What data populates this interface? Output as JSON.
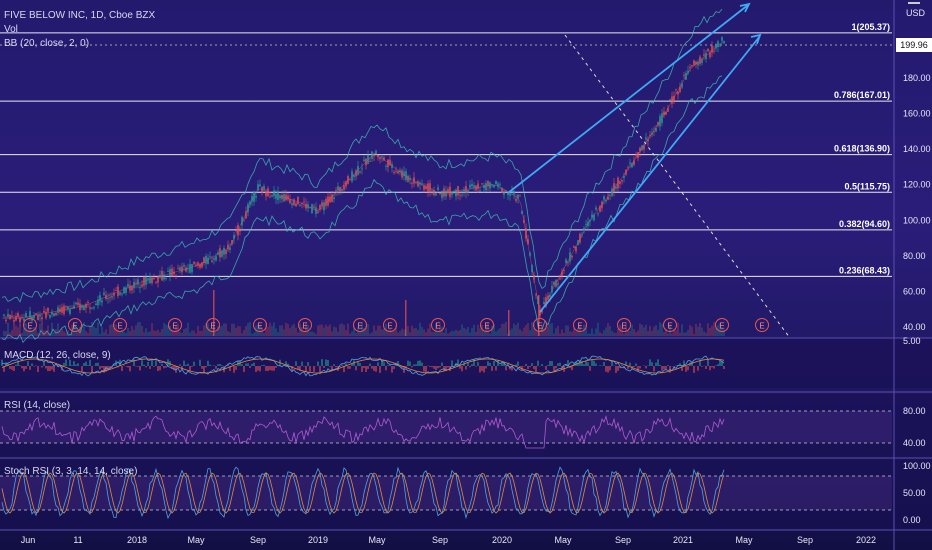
{
  "header": {
    "symbol_line": "FIVE BELOW INC, 1D, Cboe BZX",
    "vol_label": "Vol",
    "bb_label": "BB (20, close, 2, 0)"
  },
  "price_axis": {
    "currency": "USD",
    "ticks": [
      "180.00",
      "160.00",
      "140.00",
      "120.00",
      "100.00",
      "80.00",
      "60.00",
      "40.00"
    ],
    "last_price": "199.96"
  },
  "fib_levels": [
    {
      "label": "1(205.37)",
      "value": 205.37
    },
    {
      "label": "0.786(167.01)",
      "value": 167.01
    },
    {
      "label": "0.618(136.90)",
      "value": 136.9
    },
    {
      "label": "0.5(115.75)",
      "value": 115.75
    },
    {
      "label": "0.382(94.60)",
      "value": 94.6
    },
    {
      "label": "0.236(68.43)",
      "value": 68.43
    }
  ],
  "indicators": {
    "macd_label": "MACD (12, 26, close, 9)",
    "macd_tick": "5.00",
    "rsi_label": "RSI (14, close)",
    "rsi_ticks": [
      "80.00",
      "40.00"
    ],
    "stoch_label": "Stoch RSI (3, 3, 14, 14, close)",
    "stoch_ticks": [
      "100.00",
      "50.00",
      "0.00"
    ]
  },
  "time_axis": {
    "labels": [
      "Jun",
      "11",
      "2018",
      "May",
      "Sep",
      "2019",
      "May",
      "Sep",
      "2020",
      "May",
      "Sep",
      "2021",
      "May",
      "Sep",
      "2022"
    ]
  },
  "earnings_marker": "E",
  "colors": {
    "trendline": "#3fa9f5",
    "fib_line": "#ffffff",
    "bull": "#26a69a",
    "bear": "#ef5350",
    "rsi": "#b05bd0",
    "stoch_k": "#4fa3e0",
    "stoch_d": "#e08a3f"
  },
  "chart_data": {
    "type": "candlestick",
    "title": "FIVE BELOW INC, 1D, Cboe BZX",
    "y_ticks": [
      180,
      160,
      140,
      120,
      100,
      80,
      60,
      40
    ],
    "ylim": [
      35,
      215
    ],
    "x_labels": [
      "Jun",
      "11",
      "2018",
      "May",
      "Sep",
      "2019",
      "May",
      "Sep",
      "2020",
      "May",
      "Sep",
      "2021",
      "May",
      "Sep",
      "2022"
    ],
    "series": [
      {
        "x": [
          "Jun 2017",
          "Sep 2017",
          "Jan 2018",
          "May 2018",
          "Jul 2018",
          "Sep 2018",
          "Dec 2018",
          "Jan 2019",
          "Apr 2019",
          "Jul 2019",
          "Sep 2019",
          "Dec 2019",
          "Feb 2020",
          "Mar 2020",
          "Jun 2020",
          "Sep 2020",
          "Nov 2020",
          "Jan 2021",
          "Mar 2021"
        ],
        "y": [
          45,
          52,
          65,
          75,
          85,
          118,
          110,
          105,
          138,
          125,
          115,
          120,
          112,
          48,
          100,
          130,
          160,
          185,
          200
        ]
      }
    ],
    "last_price": 199.96,
    "fib_retracement": {
      "top": 205.37,
      "levels": [
        167.01,
        136.9,
        115.75,
        94.6,
        68.43
      ]
    }
  }
}
